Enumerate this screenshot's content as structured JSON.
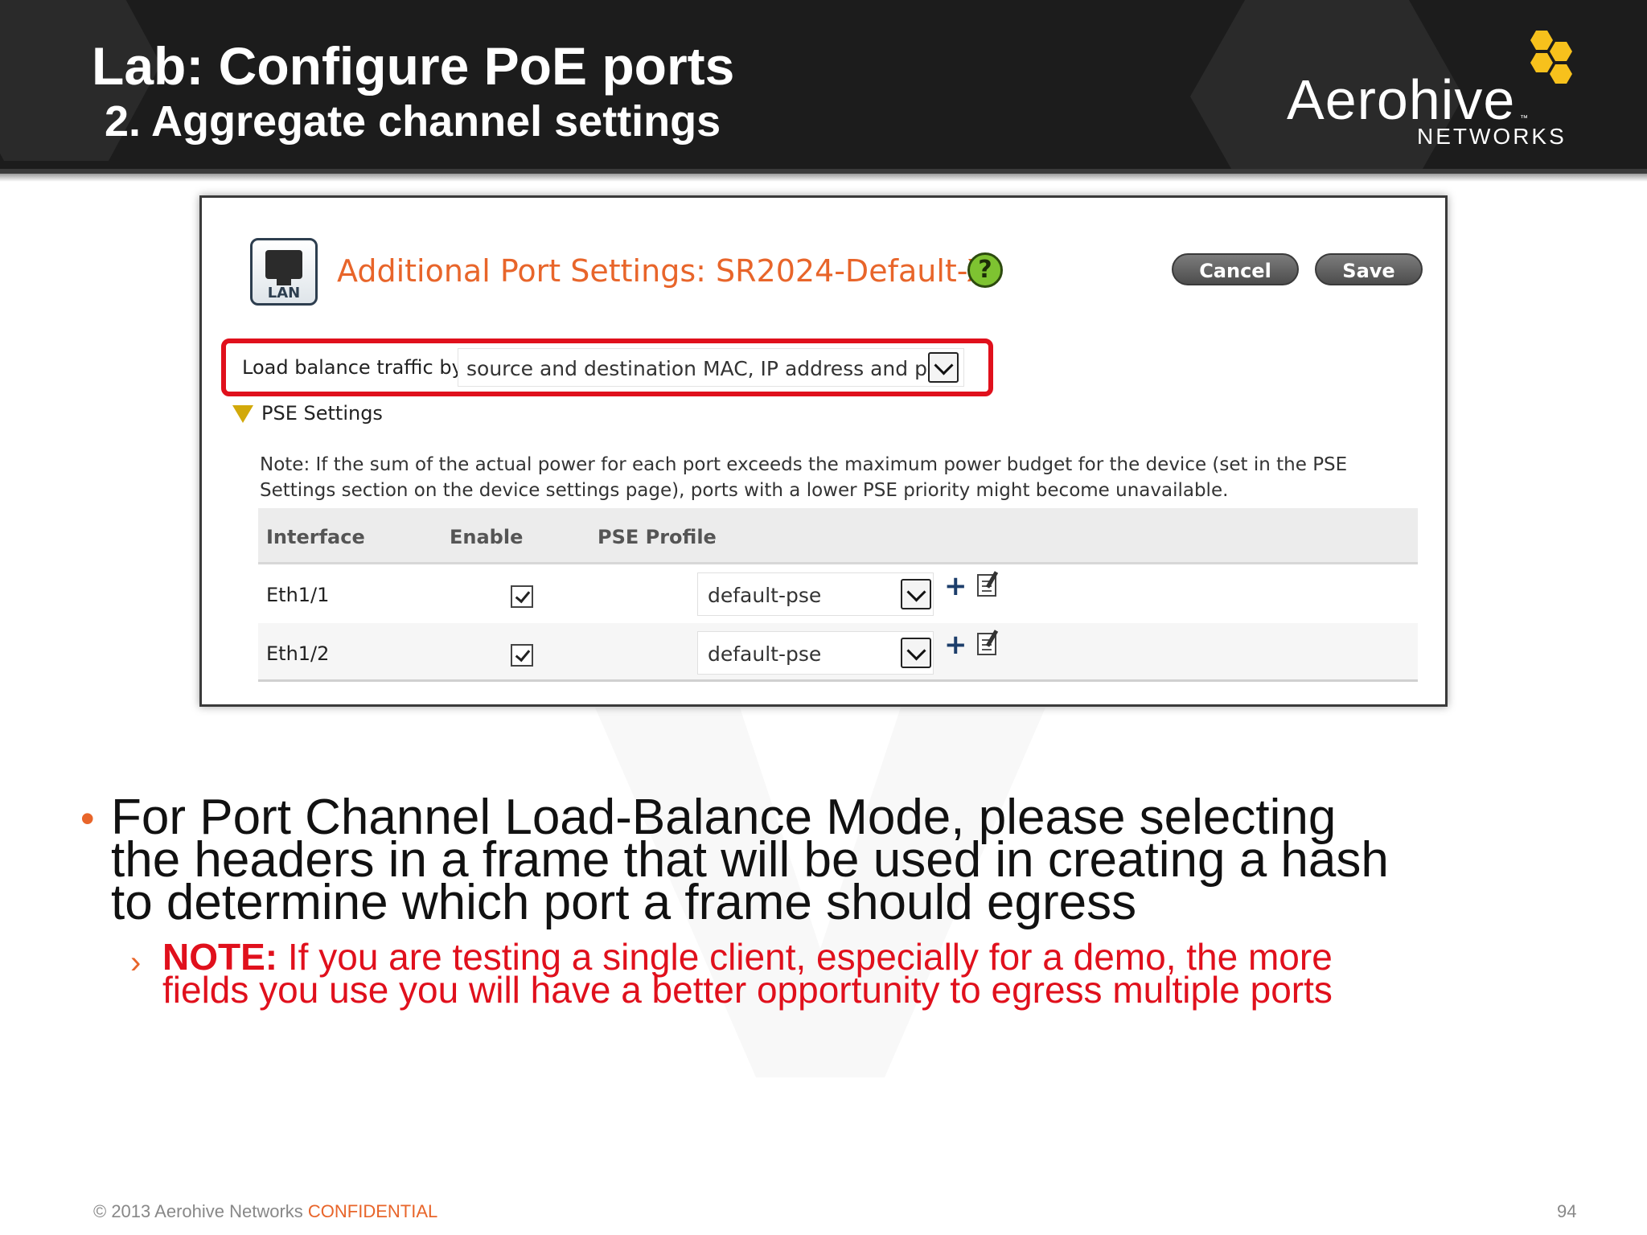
{
  "header": {
    "title": "Lab: Configure PoE ports",
    "subtitle": "2. Aggregate channel settings"
  },
  "logo": {
    "name": "Aerohive",
    "tm": "™",
    "sub": "NETWORKS",
    "icon": "honeycomb-logo-icon",
    "hex_color": "#f7c11c"
  },
  "panel": {
    "lan_label": "LAN",
    "heading": "Additional Port Settings: SR2024-Default-X",
    "help": "?",
    "cancel_label": "Cancel",
    "save_label": "Save",
    "load_balance": {
      "label": "Load balance traffic by",
      "value": "source and destination MAC, IP address and p"
    },
    "pse_section": {
      "title": "PSE Settings",
      "note": "Note: If the sum of the actual power for each port exceeds the maximum power budget for the device (set in the PSE Settings section on the device settings page), ports with a lower PSE priority might become unavailable."
    },
    "table": {
      "columns": [
        "Interface",
        "Enable",
        "PSE Profile"
      ],
      "rows": [
        {
          "interface": "Eth1/1",
          "enabled": true,
          "profile": "default-pse"
        },
        {
          "interface": "Eth1/2",
          "enabled": true,
          "profile": "default-pse"
        }
      ]
    }
  },
  "body": {
    "bullet": "For Port Channel Load-Balance Mode, please selecting the headers in a frame that will be used in creating a hash to determine which port a frame should egress",
    "sub_bullet_marker": "›",
    "note_label": "NOTE:",
    "note_text": " If you are testing a single client, especially for a demo, the more fields you use you will have a better opportunity to egress multiple ports"
  },
  "footer": {
    "copyright": "© 2013 Aerohive Networks ",
    "confidential": "CONFIDENTIAL",
    "page_number": "94"
  },
  "colors": {
    "accent": "#e8652a",
    "highlight": "#e0101c",
    "header_bg": "#1c1c1c"
  }
}
